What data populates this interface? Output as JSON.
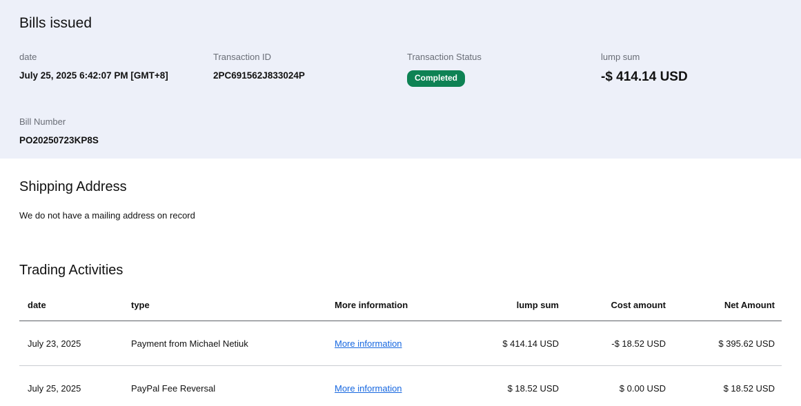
{
  "colors": {
    "header-bg": "#edf0f9",
    "badge-bg": "#0e8254",
    "badge-text": "#ffffff",
    "link": "#1667e0",
    "label-text": "#696d76",
    "heading-text": "#111111",
    "border-strong": "#5c5f66",
    "border-light": "#c9ccd1"
  },
  "header": {
    "title": "Bills issued",
    "fields": [
      {
        "label": "date",
        "value": "July 25, 2025 6:42:07 PM [GMT+8]"
      },
      {
        "label": "Transaction ID",
        "value": "2PC691562J833024P"
      },
      {
        "label": "Transaction Status",
        "badge": "Completed"
      },
      {
        "label": "lump sum",
        "value": "-$ 414.14 USD"
      }
    ],
    "bill": {
      "label": "Bill Number",
      "value": "PO20250723KP8S"
    }
  },
  "shipping": {
    "title": "Shipping Address",
    "message": "We do not have a mailing address on record"
  },
  "trading": {
    "title": "Trading Activities",
    "columns": {
      "date": "date",
      "type": "type",
      "more_info": "More information",
      "lump_sum": "lump sum",
      "cost_amount": "Cost amount",
      "net_amount": "Net Amount"
    },
    "rows": [
      {
        "date": "July 23, 2025",
        "type": "Payment from Michael Netiuk",
        "more_info": "More information",
        "lump_sum": "$ 414.14 USD",
        "cost_amount": "-$ 18.52 USD",
        "net_amount": "$ 395.62 USD"
      },
      {
        "date": "July 25, 2025",
        "type": "PayPal Fee Reversal",
        "more_info": "More information",
        "lump_sum": "$ 18.52 USD",
        "cost_amount": "$ 0.00 USD",
        "net_amount": "$ 18.52 USD"
      }
    ]
  }
}
